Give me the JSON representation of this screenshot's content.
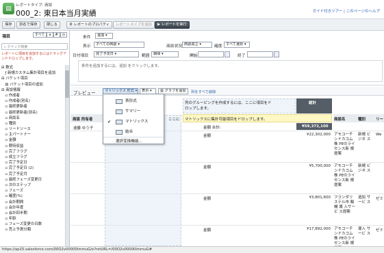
{
  "header": {
    "report_type": "レポートタイプ: 商談",
    "title": "000_2: 東日本当月実績",
    "links": "ガイド付きツアー | このページのヘルプ"
  },
  "toolbar": {
    "save": "保存",
    "save_as": "別名で保存",
    "close": "閉じる",
    "properties": "レポートのプロパティ",
    "add_report_type": "レポートタイプを追加",
    "run_report": "レポートを実行"
  },
  "fields_panel": {
    "title": "項目",
    "tabs": [
      "すべて",
      "a",
      "#",
      "◷"
    ],
    "search_placeholder": "クイック検索",
    "hint": "レポートに項目を追加するにはドラッグアンドドロップします。",
    "tree": [
      "⊟ 数式",
      "　ƒ 新規カスタム集計項目を追加",
      "⊟ バケット項目",
      "　▤ バケット項目の追加",
      "⊟ 商談情報",
      "　▫ 作成者",
      "　▫ 作成者(別名)",
      "　▫ 最終更新者",
      "　▫ 最終更新者(別名)",
      "　▫ 商談名",
      "　▫ 種別",
      "　▫ リードソース",
      "　▫ 主パートナー",
      "　▫ 金額",
      "　▫ 期待収益",
      "　▫ 完了フラグ",
      "　▫ 成立フラグ",
      "　▫ 完了予定日",
      "　▫ 完了予定日 (2)",
      "　▫ 完了予定月",
      "　▫ 最終フェーズ変更日",
      "　▫ 次のステップ",
      "　▫ フェーズ",
      "　▫ 確度(%)",
      "　▫ 会計期間",
      "　▫ 会計年度",
      "　▫ 会計四半期",
      "　▫ 年齢",
      "　▫ フェーズ変更の日数",
      "　▫ 売上予測分類"
    ]
  },
  "filters": {
    "condition_label": "条件",
    "condition_btn": "追加",
    "display_label": "表示",
    "display_value": "すべての商談",
    "status_label": "商談状況",
    "status_value": "商談成立",
    "prob_label": "確度",
    "prob_value": "すべて選択",
    "date_label": "日付項目",
    "date_value": "完了予定日",
    "range_label": "範囲",
    "range_value": "期間",
    "start_label": "開始",
    "end_label": "終了",
    "hint": "条件を追加するには、追加 をクリックします。"
  },
  "preview": {
    "label": "プレビュー",
    "format_btn": "マトリックス 形式",
    "show_btn": "表示",
    "add_chart": "グラフを追加",
    "remove_link": "列をすべて削除"
  },
  "format_menu": {
    "items": [
      "表形式",
      "サマリー",
      "マトリックス",
      "結合",
      "選択変換機能..."
    ],
    "checked_index": 2
  },
  "grid": {
    "col_drop_hint": "列のグルーピングを作成するには、ここに項目をドロップします。",
    "total_header": "総計",
    "row_drop_hint": "ここに",
    "summary_drop_hint": "マトリックスに集計可能項目をドロップします。",
    "owner_header": "商談 所有者",
    "owner_value": "遠藤 ゆう子",
    "amount_total_label": "金額 合計:",
    "amount_total_value": "¥59,372,100",
    "col_headers": [
      "商談名",
      "種別",
      "リー"
    ],
    "rows": [
      {
        "label": "金額",
        "value": "¥22,302,000",
        "name": "アモコーチ ンドカコム 株 PEのライ センス新 規提案",
        "type": "新規 ビジネ ス",
        "lead": "We"
      },
      {
        "label": "金額",
        "value": "¥5,700,000",
        "name": "アモコーチ ンドカコム 株 PEのライ センス新 規提案",
        "type": "新規 ビジネ ス",
        "lead": ""
      },
      {
        "label": "金額",
        "value": "¥3,801,600",
        "name": "フランダリ ステル市 輸機 導 入サービ ス提案",
        "type": "追加 サービ ス",
        "lead": "ゼミ"
      },
      {
        "label": "金額",
        "value": "¥17,892,000",
        "name": "アモコーチ ンドカコム 株 PEのライ センス新 規提案",
        "type": "導入 サービ ス",
        "lead": "ゼミ"
      }
    ]
  },
  "status_bar": "https://ap15.salesforce.com/00O2v00000lmmuG/e?retURL=/00O2v00000lmmuG#",
  "colors": {
    "accent": "#1f5a9e",
    "total_bg": "#555d66",
    "yellow": "#fff8c4"
  }
}
